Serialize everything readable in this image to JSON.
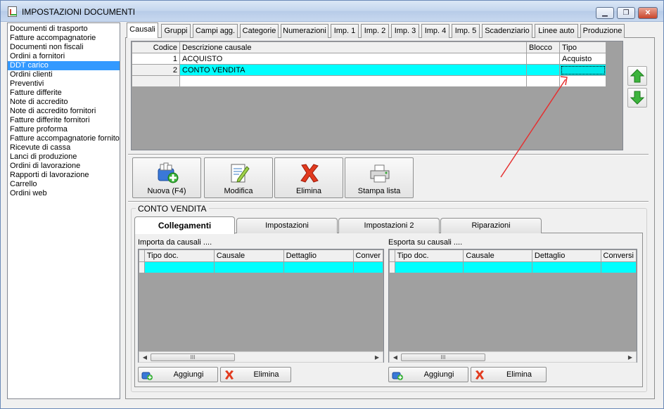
{
  "window": {
    "title": "IMPOSTAZIONI DOCUMENTI",
    "controls": [
      "▁",
      "❐",
      "✕"
    ]
  },
  "doc_list": [
    "Documenti di trasporto",
    "Fatture accompagnatorie",
    "Documenti non fiscali",
    "Ordini a fornitori",
    "DDT carico",
    "Ordini clienti",
    "Preventivi",
    "Fatture differite",
    "Note di accredito",
    "Note di accredito fornitori",
    "Fatture differite fornitori",
    "Fatture proforma",
    "Fatture accompagnatorie fornitori",
    "Ricevute di cassa",
    "Lanci di produzione",
    "Ordini di lavorazione",
    "Rapporti di lavorazione",
    "Carrello",
    "Ordini web"
  ],
  "selected_doc": "DDT carico",
  "tabs": [
    "Causali",
    "Gruppi",
    "Campi agg.",
    "Categorie",
    "Numerazioni",
    "Imp. 1",
    "Imp. 2",
    "Imp. 3",
    "Imp. 4",
    "Imp. 5",
    "Scadenziario",
    "Linee auto",
    "Produzione"
  ],
  "active_tab": "Causali",
  "causali_grid": {
    "headers": [
      "Codice",
      "Descrizione causale",
      "Blocco",
      "Tipo"
    ],
    "rows": [
      {
        "codice": "1",
        "descrizione": "ACQUISTO",
        "blocco": "",
        "tipo": "Acquisto"
      },
      {
        "codice": "2",
        "descrizione": "CONTO VENDITA",
        "blocco": "",
        "tipo": ""
      }
    ]
  },
  "toolbar": {
    "new": "Nuova (F4)",
    "edit": "Modifica",
    "delete": "Elimina",
    "print": "Stampa lista"
  },
  "group_title": "CONTO VENDITA",
  "subtabs": [
    "Collegamenti",
    "Impostazioni",
    "Impostazioni 2",
    "Riparazioni"
  ],
  "active_subtab": "Collegamenti",
  "import_section": {
    "label": "Importa da causali ....",
    "headers": [
      "Tipo doc.",
      "Causale",
      "Dettaglio",
      "Conver"
    ],
    "add": "Aggiungi",
    "delete": "Elimina",
    "scroll_thumb": "III"
  },
  "export_section": {
    "label": "Esporta su causali ....",
    "headers": [
      "Tipo doc.",
      "Causale",
      "Dettaglio",
      "Conversi"
    ],
    "add": "Aggiungi",
    "delete": "Elimina",
    "scroll_thumb": "III"
  },
  "colors": {
    "selection": "#00ffff",
    "list_selection": "#3399ff",
    "annotation": "#e53030"
  }
}
